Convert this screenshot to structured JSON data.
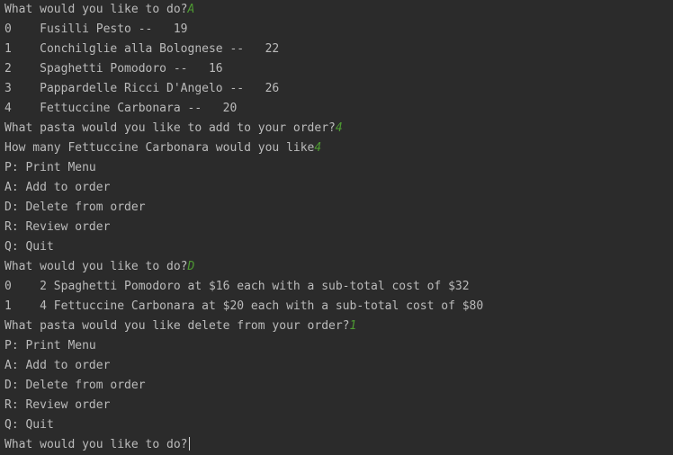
{
  "console": {
    "lines": [
      {
        "text": "What would you like to do?",
        "input": "A"
      },
      {
        "text": "0    Fusilli Pesto --   19",
        "input": ""
      },
      {
        "text": "1    Conchilglie alla Bolognese --   22",
        "input": ""
      },
      {
        "text": "2    Spaghetti Pomodoro --   16",
        "input": ""
      },
      {
        "text": "3    Pappardelle Ricci D'Angelo --   26",
        "input": ""
      },
      {
        "text": "4    Fettuccine Carbonara --   20",
        "input": ""
      },
      {
        "text": "What pasta would you like to add to your order?",
        "input": "4"
      },
      {
        "text": "How many Fettuccine Carbonara would you like",
        "input": "4"
      },
      {
        "text": "P: Print Menu",
        "input": ""
      },
      {
        "text": "A: Add to order",
        "input": ""
      },
      {
        "text": "D: Delete from order",
        "input": ""
      },
      {
        "text": "R: Review order",
        "input": ""
      },
      {
        "text": "Q: Quit",
        "input": ""
      },
      {
        "text": "What would you like to do?",
        "input": "D"
      },
      {
        "text": "0    2 Spaghetti Pomodoro at $16 each with a sub-total cost of $32",
        "input": ""
      },
      {
        "text": "1    4 Fettuccine Carbonara at $20 each with a sub-total cost of $80",
        "input": ""
      },
      {
        "text": "What pasta would you like delete from your order?",
        "input": "1"
      },
      {
        "text": "P: Print Menu",
        "input": ""
      },
      {
        "text": "A: Add to order",
        "input": ""
      },
      {
        "text": "D: Delete from order",
        "input": ""
      },
      {
        "text": "R: Review order",
        "input": ""
      },
      {
        "text": "Q: Quit",
        "input": ""
      },
      {
        "text": "What would you like to do?",
        "input": ""
      }
    ]
  },
  "colors": {
    "background": "#2b2b2b",
    "output_text": "#bbbbbb",
    "user_input": "#4e9a32"
  }
}
